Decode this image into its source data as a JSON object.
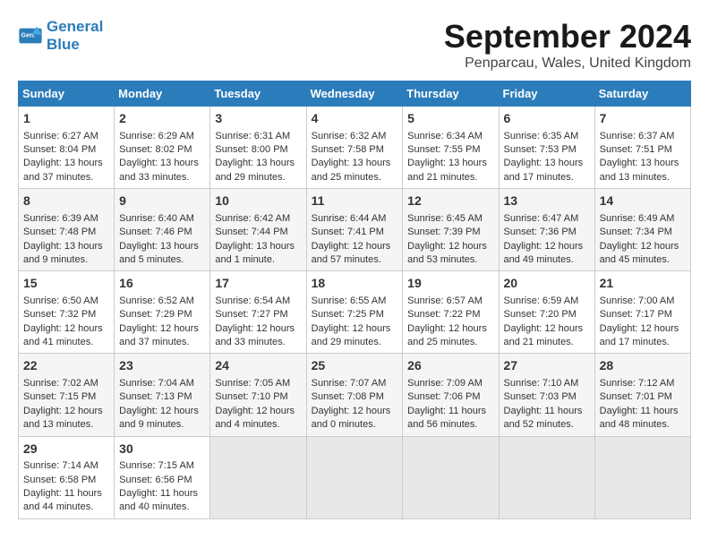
{
  "header": {
    "logo_line1": "General",
    "logo_line2": "Blue",
    "month_title": "September 2024",
    "location": "Penparcau, Wales, United Kingdom"
  },
  "columns": [
    "Sunday",
    "Monday",
    "Tuesday",
    "Wednesday",
    "Thursday",
    "Friday",
    "Saturday"
  ],
  "weeks": [
    [
      {
        "day": "1",
        "lines": [
          "Sunrise: 6:27 AM",
          "Sunset: 8:04 PM",
          "Daylight: 13 hours",
          "and 37 minutes."
        ]
      },
      {
        "day": "2",
        "lines": [
          "Sunrise: 6:29 AM",
          "Sunset: 8:02 PM",
          "Daylight: 13 hours",
          "and 33 minutes."
        ]
      },
      {
        "day": "3",
        "lines": [
          "Sunrise: 6:31 AM",
          "Sunset: 8:00 PM",
          "Daylight: 13 hours",
          "and 29 minutes."
        ]
      },
      {
        "day": "4",
        "lines": [
          "Sunrise: 6:32 AM",
          "Sunset: 7:58 PM",
          "Daylight: 13 hours",
          "and 25 minutes."
        ]
      },
      {
        "day": "5",
        "lines": [
          "Sunrise: 6:34 AM",
          "Sunset: 7:55 PM",
          "Daylight: 13 hours",
          "and 21 minutes."
        ]
      },
      {
        "day": "6",
        "lines": [
          "Sunrise: 6:35 AM",
          "Sunset: 7:53 PM",
          "Daylight: 13 hours",
          "and 17 minutes."
        ]
      },
      {
        "day": "7",
        "lines": [
          "Sunrise: 6:37 AM",
          "Sunset: 7:51 PM",
          "Daylight: 13 hours",
          "and 13 minutes."
        ]
      }
    ],
    [
      {
        "day": "8",
        "lines": [
          "Sunrise: 6:39 AM",
          "Sunset: 7:48 PM",
          "Daylight: 13 hours",
          "and 9 minutes."
        ]
      },
      {
        "day": "9",
        "lines": [
          "Sunrise: 6:40 AM",
          "Sunset: 7:46 PM",
          "Daylight: 13 hours",
          "and 5 minutes."
        ]
      },
      {
        "day": "10",
        "lines": [
          "Sunrise: 6:42 AM",
          "Sunset: 7:44 PM",
          "Daylight: 13 hours",
          "and 1 minute."
        ]
      },
      {
        "day": "11",
        "lines": [
          "Sunrise: 6:44 AM",
          "Sunset: 7:41 PM",
          "Daylight: 12 hours",
          "and 57 minutes."
        ]
      },
      {
        "day": "12",
        "lines": [
          "Sunrise: 6:45 AM",
          "Sunset: 7:39 PM",
          "Daylight: 12 hours",
          "and 53 minutes."
        ]
      },
      {
        "day": "13",
        "lines": [
          "Sunrise: 6:47 AM",
          "Sunset: 7:36 PM",
          "Daylight: 12 hours",
          "and 49 minutes."
        ]
      },
      {
        "day": "14",
        "lines": [
          "Sunrise: 6:49 AM",
          "Sunset: 7:34 PM",
          "Daylight: 12 hours",
          "and 45 minutes."
        ]
      }
    ],
    [
      {
        "day": "15",
        "lines": [
          "Sunrise: 6:50 AM",
          "Sunset: 7:32 PM",
          "Daylight: 12 hours",
          "and 41 minutes."
        ]
      },
      {
        "day": "16",
        "lines": [
          "Sunrise: 6:52 AM",
          "Sunset: 7:29 PM",
          "Daylight: 12 hours",
          "and 37 minutes."
        ]
      },
      {
        "day": "17",
        "lines": [
          "Sunrise: 6:54 AM",
          "Sunset: 7:27 PM",
          "Daylight: 12 hours",
          "and 33 minutes."
        ]
      },
      {
        "day": "18",
        "lines": [
          "Sunrise: 6:55 AM",
          "Sunset: 7:25 PM",
          "Daylight: 12 hours",
          "and 29 minutes."
        ]
      },
      {
        "day": "19",
        "lines": [
          "Sunrise: 6:57 AM",
          "Sunset: 7:22 PM",
          "Daylight: 12 hours",
          "and 25 minutes."
        ]
      },
      {
        "day": "20",
        "lines": [
          "Sunrise: 6:59 AM",
          "Sunset: 7:20 PM",
          "Daylight: 12 hours",
          "and 21 minutes."
        ]
      },
      {
        "day": "21",
        "lines": [
          "Sunrise: 7:00 AM",
          "Sunset: 7:17 PM",
          "Daylight: 12 hours",
          "and 17 minutes."
        ]
      }
    ],
    [
      {
        "day": "22",
        "lines": [
          "Sunrise: 7:02 AM",
          "Sunset: 7:15 PM",
          "Daylight: 12 hours",
          "and 13 minutes."
        ]
      },
      {
        "day": "23",
        "lines": [
          "Sunrise: 7:04 AM",
          "Sunset: 7:13 PM",
          "Daylight: 12 hours",
          "and 9 minutes."
        ]
      },
      {
        "day": "24",
        "lines": [
          "Sunrise: 7:05 AM",
          "Sunset: 7:10 PM",
          "Daylight: 12 hours",
          "and 4 minutes."
        ]
      },
      {
        "day": "25",
        "lines": [
          "Sunrise: 7:07 AM",
          "Sunset: 7:08 PM",
          "Daylight: 12 hours",
          "and 0 minutes."
        ]
      },
      {
        "day": "26",
        "lines": [
          "Sunrise: 7:09 AM",
          "Sunset: 7:06 PM",
          "Daylight: 11 hours",
          "and 56 minutes."
        ]
      },
      {
        "day": "27",
        "lines": [
          "Sunrise: 7:10 AM",
          "Sunset: 7:03 PM",
          "Daylight: 11 hours",
          "and 52 minutes."
        ]
      },
      {
        "day": "28",
        "lines": [
          "Sunrise: 7:12 AM",
          "Sunset: 7:01 PM",
          "Daylight: 11 hours",
          "and 48 minutes."
        ]
      }
    ],
    [
      {
        "day": "29",
        "lines": [
          "Sunrise: 7:14 AM",
          "Sunset: 6:58 PM",
          "Daylight: 11 hours",
          "and 44 minutes."
        ]
      },
      {
        "day": "30",
        "lines": [
          "Sunrise: 7:15 AM",
          "Sunset: 6:56 PM",
          "Daylight: 11 hours",
          "and 40 minutes."
        ]
      },
      {
        "day": "",
        "lines": []
      },
      {
        "day": "",
        "lines": []
      },
      {
        "day": "",
        "lines": []
      },
      {
        "day": "",
        "lines": []
      },
      {
        "day": "",
        "lines": []
      }
    ]
  ]
}
